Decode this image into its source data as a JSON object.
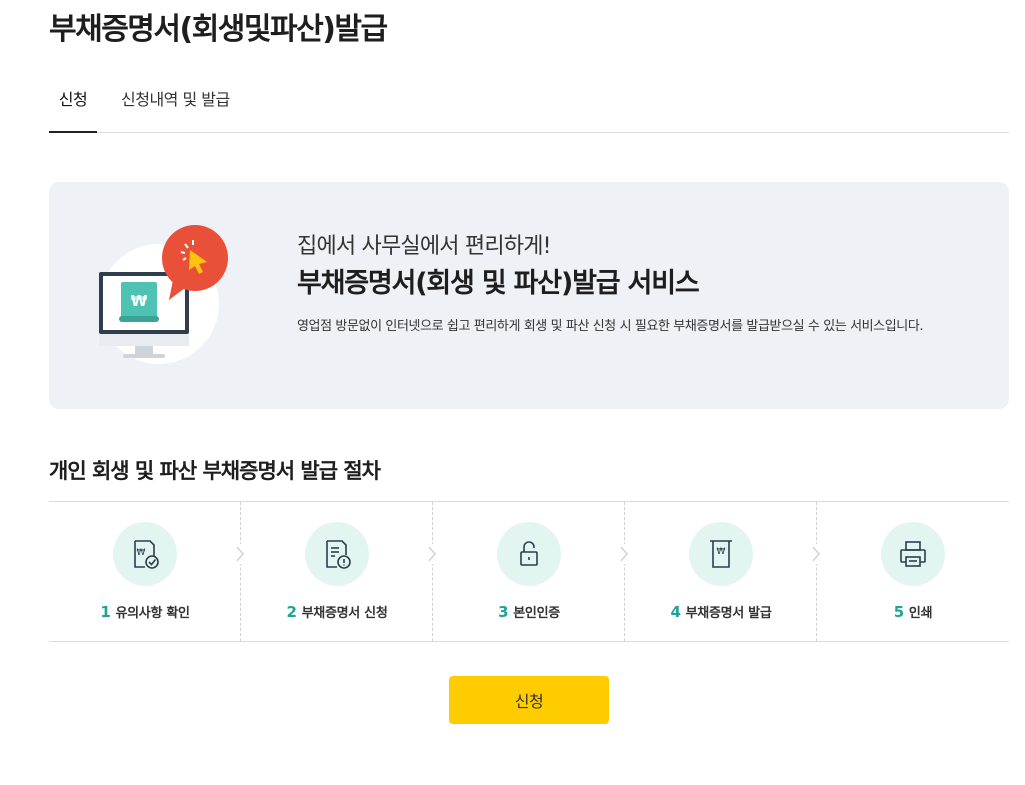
{
  "page": {
    "title": "부채증명서(회생및파산)발급"
  },
  "tabs": [
    {
      "label": "신청",
      "active": true
    },
    {
      "label": "신청내역 및 발급",
      "active": false
    }
  ],
  "banner": {
    "subtitle": "집에서 사무실에서 편리하게!",
    "title": "부채증명서(회생 및 파산)발급 서비스",
    "description": "영업점 방문없이 인터넷으로 쉽고 편리하게 회생 및 파산 신청 시 필요한 부채증명서를 발급받으실 수 있는 서비스입니다.",
    "icon": "monitor-won-document-icon"
  },
  "procedure": {
    "title": "개인 회생 및 파산 부채증명서 발급 절차",
    "steps": [
      {
        "num": "1",
        "label": "유의사항 확인",
        "icon": "document-check-icon"
      },
      {
        "num": "2",
        "label": "부채증명서 신청",
        "icon": "document-alert-icon"
      },
      {
        "num": "3",
        "label": "본인인증",
        "icon": "unlock-icon"
      },
      {
        "num": "4",
        "label": "부채증명서 발급",
        "icon": "won-document-icon"
      },
      {
        "num": "5",
        "label": "인쇄",
        "icon": "printer-icon"
      }
    ]
  },
  "actions": {
    "apply_label": "신청"
  },
  "colors": {
    "accent_yellow": "#ffcc00",
    "accent_teal": "#1fa396",
    "banner_bg": "#eef1f6",
    "icon_bg": "#e3f5f1",
    "badge_red": "#e8503a"
  }
}
